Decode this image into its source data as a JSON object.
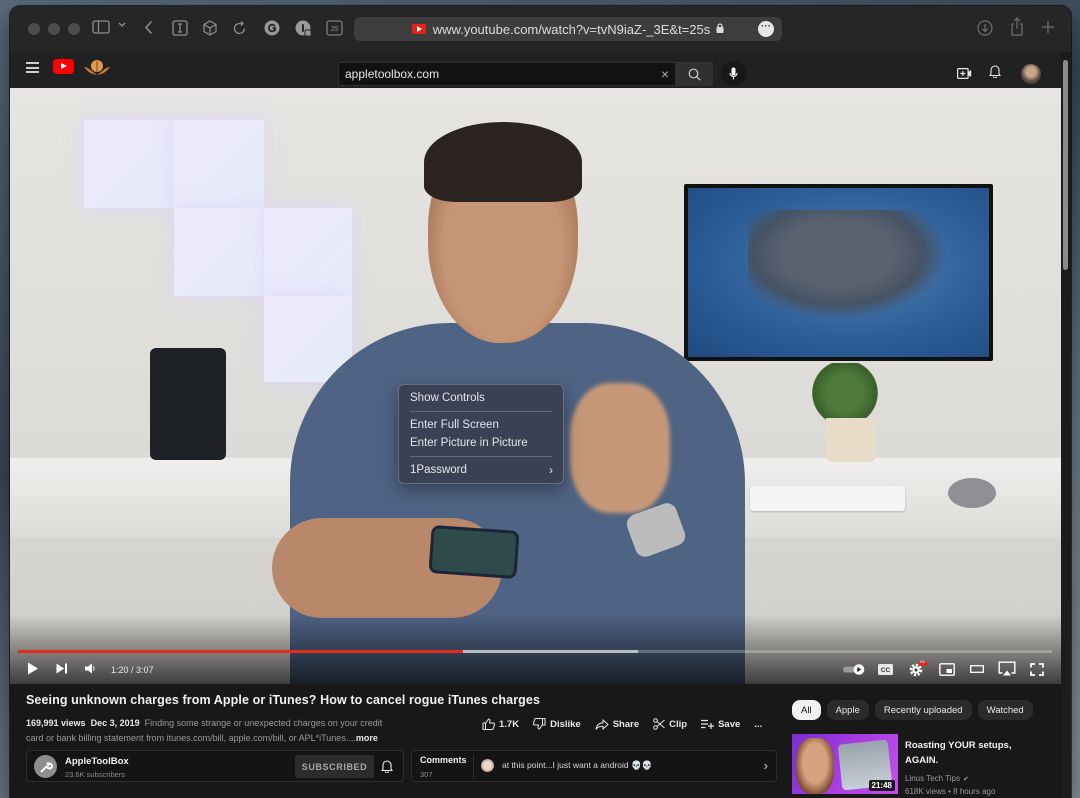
{
  "browser": {
    "url": "www.youtube.com/watch?v=tvN9iaZ-_3E&t=25s",
    "toolbar_icons": [
      "sidebar-icon",
      "chevron-down-icon",
      "back-icon",
      "reader-icon",
      "box-icon",
      "reload-icon",
      "grammarly-icon",
      "1password-icon",
      "js-icon"
    ],
    "right_icons": [
      "download-icon",
      "share-icon",
      "new-tab-icon"
    ]
  },
  "youtube_header": {
    "search_value": "appletoolbox.com",
    "clear_symbol": "×"
  },
  "context_menu": {
    "items": [
      {
        "label": "Show Controls"
      },
      {
        "label": "Enter Full Screen"
      },
      {
        "label": "Enter Picture in Picture"
      },
      {
        "label": "1Password",
        "submenu_arrow": "›"
      }
    ]
  },
  "player": {
    "current_time": "1:20",
    "duration": "3:07",
    "time_display": "1:20 / 3:07",
    "played_fraction": 0.43,
    "buffered_fraction": 0.6,
    "settings_badge": "HD",
    "accent_color": "#e22b1e"
  },
  "video_info": {
    "title": "Seeing unknown charges from Apple or iTunes? How to cancel rogue iTunes charges",
    "views": "169,991 views",
    "date": "Dec 3, 2019",
    "description": "Finding some strange or unexpected charges on your credit card or bank billing statement from itunes.com/bill, apple.com/bill, or APL*iTunes....",
    "more_label": "more",
    "actions": {
      "like_count": "1.7K",
      "dislike": "Dislike",
      "share": "Share",
      "clip": "Clip",
      "save": "Save",
      "more": "..."
    }
  },
  "channel": {
    "name": "AppleToolBox",
    "subscribers": "23.6K subscribers",
    "subscribe_label": "SUBSCRIBED"
  },
  "comments": {
    "label": "Comments",
    "count": "307",
    "top_comment": "at this point...I just want a android 💀💀",
    "arrow": "›"
  },
  "sidebar": {
    "chips": [
      {
        "label": "All",
        "active": true
      },
      {
        "label": "Apple"
      },
      {
        "label": "Recently uploaded"
      },
      {
        "label": "Watched"
      }
    ],
    "recommended": [
      {
        "title": "Roasting YOUR setups, AGAIN.",
        "channel": "Linus Tech Tips",
        "verified": "✔",
        "meta": "618K views • 8 hours ago",
        "duration": "21:48"
      }
    ]
  }
}
